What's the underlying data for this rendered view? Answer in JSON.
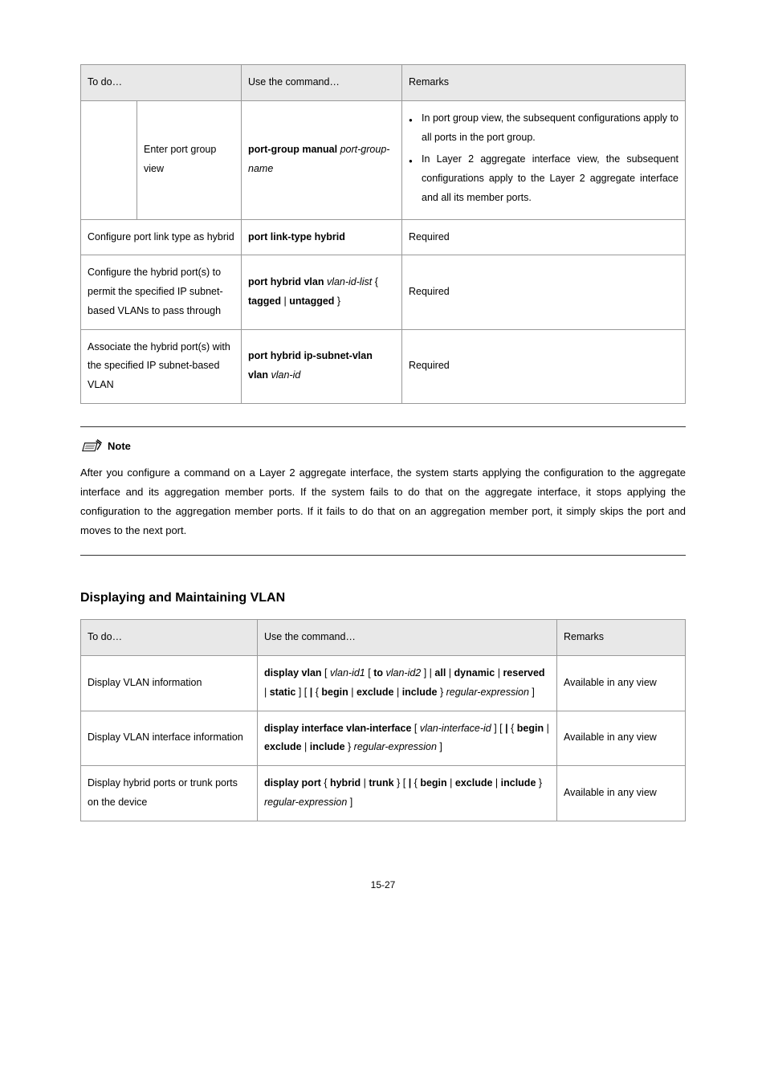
{
  "table1": {
    "headers": [
      "To do…",
      "Use the command…",
      "Remarks"
    ],
    "row1": {
      "c1b": "Enter port group view",
      "cmd_b1": "port-group manual",
      "cmd_i1": "port-group-name",
      "r_b1": "In port group view, the subsequent configurations apply to all ports in the port group.",
      "r_b2": "In Layer 2 aggregate interface view, the subsequent configurations apply to the Layer 2 aggregate interface and all its member ports."
    },
    "row2": {
      "c1": "Configure port link type as hybrid",
      "cmd": "port link-type hybrid",
      "r": "Required"
    },
    "row3": {
      "c1": "Configure the hybrid port(s) to permit the specified IP subnet-based VLANs to pass through",
      "cmd_b1": "port hybrid vlan",
      "cmd_i1": "vlan-id-list",
      "cmd_t1": "{ ",
      "cmd_b2": "tagged",
      "cmd_t2": " | ",
      "cmd_b3": "untagged",
      "cmd_t3": " }",
      "r": "Required"
    },
    "row4": {
      "c1": "Associate the hybrid port(s) with the specified IP subnet-based VLAN",
      "cmd_b1": "port hybrid ip-subnet-vlan vlan",
      "cmd_i1": "vlan-id",
      "r": "Required"
    }
  },
  "note": {
    "label": "Note",
    "text": "After you configure a command on a Layer 2 aggregate interface, the system starts applying the configuration to the aggregate interface and its aggregation member ports. If the system fails to do that on the aggregate interface, it stops applying the configuration to the aggregation member ports. If it fails to do that on an aggregation member port, it simply skips the port and moves to the next port."
  },
  "section_heading": "Displaying and Maintaining VLAN",
  "table2": {
    "headers": [
      "To do…",
      "Use the command…",
      "Remarks"
    ],
    "row1": {
      "c1": "Display VLAN information",
      "r": "Available in any view"
    },
    "row2": {
      "c1": "Display VLAN interface information",
      "r": "Available in any view"
    },
    "row3": {
      "c1": "Display hybrid ports or trunk ports on the device",
      "r": "Available in any view"
    }
  },
  "page_num": "15-27"
}
